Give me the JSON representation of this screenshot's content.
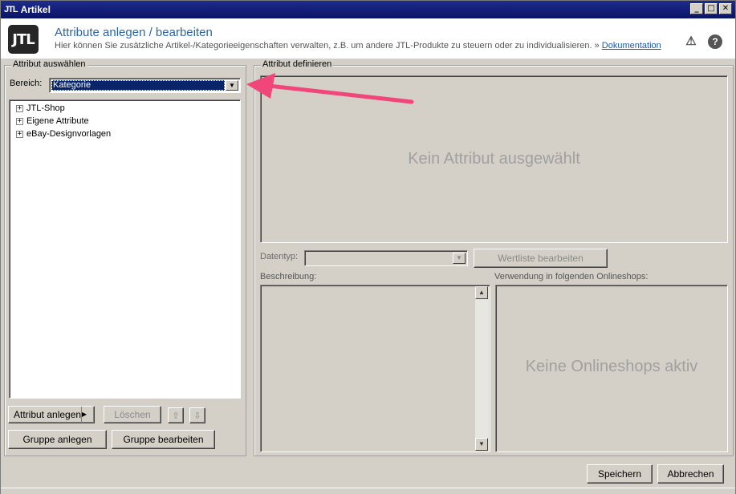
{
  "window": {
    "logo_text": "JTL",
    "title": "Artikel",
    "controls": [
      "_",
      "□",
      "✕"
    ]
  },
  "header": {
    "logo": "JTL",
    "title": "Attribute anlegen / bearbeiten",
    "subtitle": "Hier können Sie zusätzliche Artikel-/Kategorieeigenschaften verwalten, z.B. um andere JTL-Produkte zu steuern oder zu individualisieren. »",
    "doc_link": "Dokumentation",
    "warn_icon": "⚠",
    "help_icon": "?"
  },
  "left": {
    "group_label": "Attribut auswählen",
    "scope_label": "Bereich:",
    "scope_value": "Kategorie",
    "tree": [
      {
        "label": "JTL-Shop",
        "expander": "+"
      },
      {
        "label": "Eigene Attribute",
        "expander": "+"
      },
      {
        "label": "eBay-Designvorlagen",
        "expander": "+"
      }
    ],
    "buttons": {
      "create_attribute": "Attribut anlegen",
      "delete": "Löschen",
      "up": "⇧",
      "down": "⇩",
      "create_group": "Gruppe anlegen",
      "edit_group": "Gruppe bearbeiten"
    }
  },
  "right": {
    "group_label": "Attribut definieren",
    "empty_text": "Kein Attribut ausgewählt",
    "datatype_label": "Datentyp:",
    "datatype_value": "",
    "valuelist_button": "Wertliste bearbeiten",
    "description_label": "Beschreibung:",
    "shops_label": "Verwendung in folgenden Onlineshops:",
    "shops_empty": "Keine Onlineshops aktiv"
  },
  "footer": {
    "save": "Speichern",
    "cancel": "Abbrechen"
  },
  "colors": {
    "titlebar": "#0a246a",
    "accent_title": "#2b65a7",
    "annotation_arrow": "#f0467a",
    "dialog_bg": "#d4d0c8"
  }
}
